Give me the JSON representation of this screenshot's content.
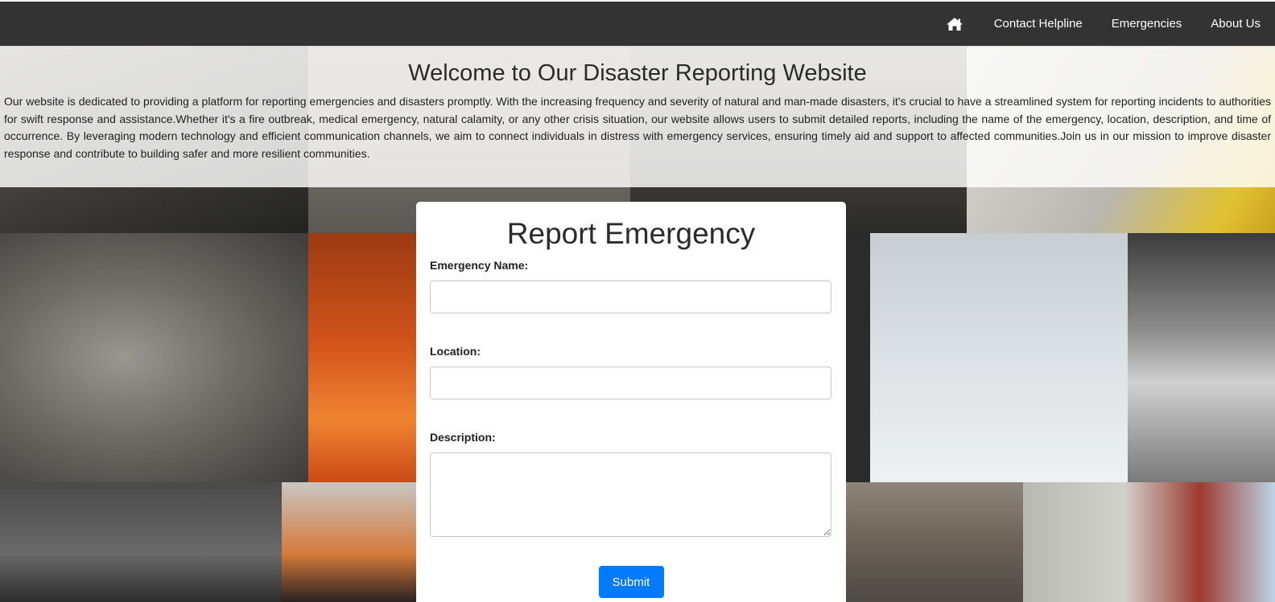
{
  "nav": {
    "home_icon": "home-icon",
    "links": [
      "Contact Helpline",
      "Emergencies",
      "About Us"
    ]
  },
  "hero": {
    "title": "Welcome to Our Disaster Reporting Website",
    "text": "Our website is dedicated to providing a platform for reporting emergencies and disasters promptly. With the increasing frequency and severity of natural and man-made disasters, it's crucial to have a streamlined system for reporting incidents to authorities for swift response and assistance.Whether it's a fire outbreak, medical emergency, natural calamity, or any other crisis situation, our website allows users to submit detailed reports, including the name of the emergency, location, description, and time of occurrence. By leveraging modern technology and efficient communication channels, we aim to connect individuals in distress with emergency services, ensuring timely aid and support to affected communities.Join us in our mission to improve disaster response and contribute to building safer and more resilient communities."
  },
  "form": {
    "title": "Report Emergency",
    "name_label": "Emergency Name:",
    "name_value": "",
    "location_label": "Location:",
    "location_value": "",
    "description_label": "Description:",
    "description_value": "",
    "submit_label": "Submit"
  },
  "colors": {
    "navbar": "#333333",
    "accent": "#007bff"
  }
}
